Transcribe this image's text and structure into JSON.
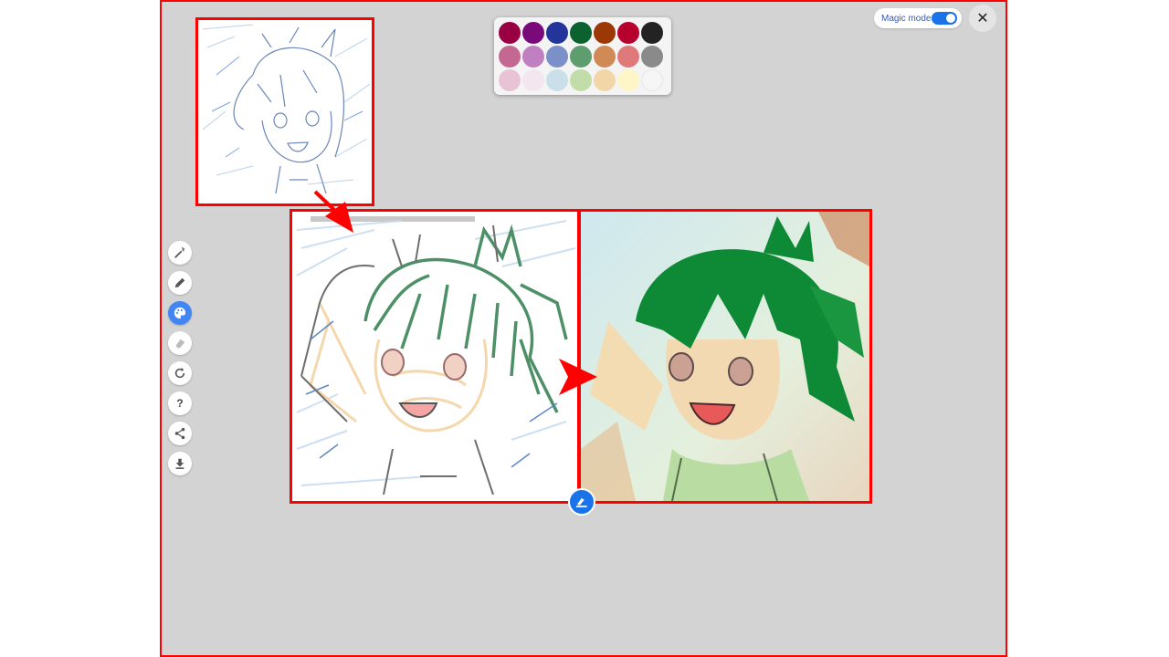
{
  "header": {
    "magic_mode_label": "Magic mode",
    "magic_mode_on": true,
    "close_label": "✕"
  },
  "palette": {
    "colors": [
      "#990044",
      "#7a0a7a",
      "#23349a",
      "#0b6130",
      "#9b3806",
      "#b8002e",
      "#232323",
      "#c46891",
      "#c07fc0",
      "#7b8fc8",
      "#5e9e6e",
      "#d08a55",
      "#e07a7a",
      "#8a8a8a",
      "#e8c3d6",
      "#f3e6ef",
      "#c9dfea",
      "#c2dcaa",
      "#f3d6a8",
      "#fff6c8",
      "#f6f6f6"
    ]
  },
  "toolbar": {
    "tools": [
      {
        "name": "magic-wand-icon",
        "active": false
      },
      {
        "name": "pencil-icon",
        "active": false
      },
      {
        "name": "palette-icon",
        "active": true
      },
      {
        "name": "eraser-icon",
        "active": false
      },
      {
        "name": "refresh-icon",
        "active": false
      },
      {
        "name": "help-icon",
        "active": false,
        "label": "?"
      },
      {
        "name": "share-icon",
        "active": false
      },
      {
        "name": "download-icon",
        "active": false
      }
    ]
  },
  "colors": {
    "highlight": "#ff0000",
    "accent": "#1a73e8",
    "background": "#d3d3d3"
  }
}
